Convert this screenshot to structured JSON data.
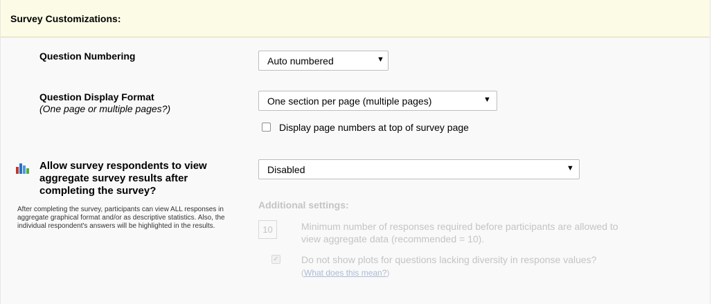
{
  "section": {
    "title": "Survey Customizations:"
  },
  "question_numbering": {
    "label": "Question Numbering",
    "selected": "Auto numbered"
  },
  "display_format": {
    "label": "Question Display Format",
    "sublabel": "(One page or multiple pages?)",
    "selected": "One section per page (multiple pages)",
    "page_numbers_checkbox": {
      "label": "Display page numbers at top of survey page",
      "checked": false
    }
  },
  "aggregate": {
    "label_line1": "Allow survey respondents to view",
    "label_line2": "aggregate survey results after",
    "label_line3": "completing the survey?",
    "description": "After completing the survey, participants can view ALL responses in aggregate graphical format and/or as descriptive statistics. Also, the individual respondent's answers will be highlighted in the results.",
    "selected": "Disabled",
    "additional_settings": {
      "title": "Additional settings:",
      "min_responses_value": "10",
      "min_responses_line1": "Minimum number of responses required before participants are allowed to",
      "min_responses_line2": "view aggregate data (recommended = 10).",
      "no_plots_label": "Do not show plots for questions lacking diversity in response values?",
      "no_plots_checked": true,
      "link_open": "(",
      "link_text": "What does this mean?",
      "link_close": ")"
    }
  },
  "colors": {
    "header_bg": "#fcfbe6",
    "panel_bg": "#f9f9f9",
    "disabled_text": "#c4c4c4"
  },
  "icons": {
    "aggregate": "bar-chart-icon",
    "dropdown": "caret-down-icon"
  }
}
